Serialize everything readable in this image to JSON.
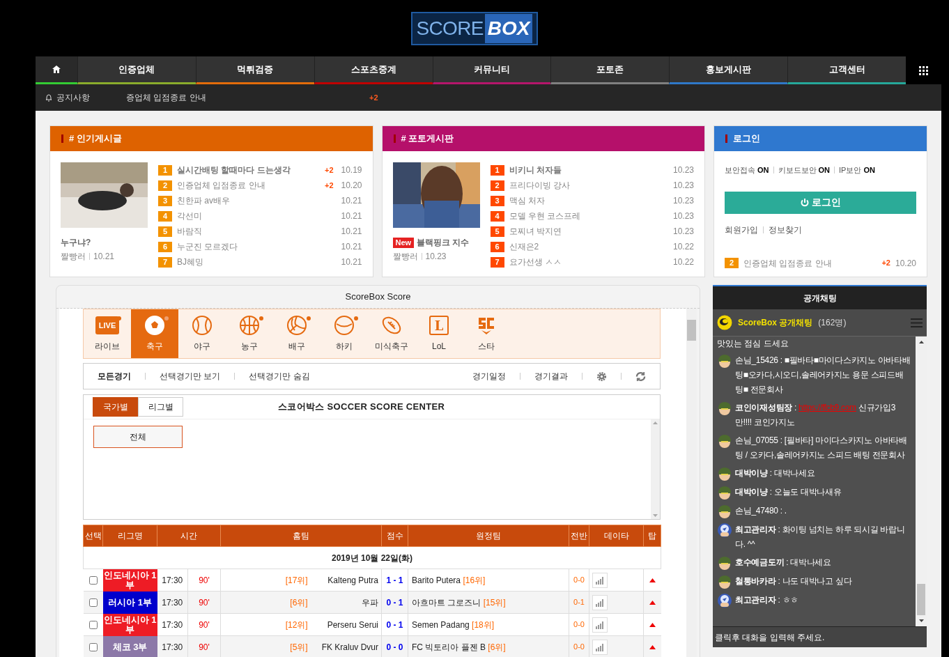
{
  "logo": {
    "left": "SCORE",
    "right": "BOX"
  },
  "nav": {
    "items": [
      {
        "label": "인증업체",
        "color": "#8aac2c"
      },
      {
        "label": "먹튀검증",
        "color": "#e36c0a"
      },
      {
        "label": "스포츠중계",
        "color": "#c00000"
      },
      {
        "label": "커뮤니티",
        "color": "#b5166b"
      },
      {
        "label": "포토존",
        "color": "#808080"
      },
      {
        "label": "홍보게시판",
        "color": "#2f78c8"
      },
      {
        "label": "고객센터",
        "color": "#25a89a"
      }
    ]
  },
  "notice": {
    "label": "공지사항",
    "text": "증업체 입점종료 안내",
    "count": "+2"
  },
  "popular": {
    "title": "# 인기게시글",
    "feature": {
      "title": "누구냐?",
      "author": "짤빵러",
      "date": "10.21"
    },
    "items": [
      {
        "rank": "1",
        "title": "실시간배팅 할때마다 드는생각",
        "bold": true,
        "count": "+2",
        "date": "10.19"
      },
      {
        "rank": "2",
        "title": "인증업체 입점종료 안내",
        "bold": false,
        "count": "+2",
        "date": "10.20"
      },
      {
        "rank": "3",
        "title": "친한파 av배우",
        "bold": false,
        "date": "10.21"
      },
      {
        "rank": "4",
        "title": "각선미",
        "bold": false,
        "date": "10.21"
      },
      {
        "rank": "5",
        "title": "바람직",
        "bold": false,
        "date": "10.21"
      },
      {
        "rank": "6",
        "title": "누군진 모르겠다",
        "bold": false,
        "date": "10.21"
      },
      {
        "rank": "7",
        "title": "BJ혜밍",
        "bold": false,
        "date": "10.21"
      }
    ]
  },
  "photo": {
    "title": "# 포토게시판",
    "feature": {
      "badge": "New",
      "title": "블랙핑크 지수",
      "author": "짤빵러",
      "date": "10.23"
    },
    "items": [
      {
        "rank": "1",
        "title": "비키니 처자들",
        "bold": true,
        "date": "10.23"
      },
      {
        "rank": "2",
        "title": "프리다이빙 강사",
        "bold": false,
        "date": "10.23"
      },
      {
        "rank": "3",
        "title": "맥심 처자",
        "bold": false,
        "date": "10.23"
      },
      {
        "rank": "4",
        "title": "모델 우현 코스프레",
        "bold": false,
        "date": "10.23"
      },
      {
        "rank": "5",
        "title": "모찌녀 박지연",
        "bold": false,
        "date": "10.23"
      },
      {
        "rank": "6",
        "title": "신재은2",
        "bold": false,
        "date": "10.22"
      },
      {
        "rank": "7",
        "title": "요가선생 ㅅㅅ",
        "bold": false,
        "date": "10.22"
      }
    ]
  },
  "login": {
    "title": "로그인",
    "security": [
      {
        "label": "보안접속",
        "value": "ON"
      },
      {
        "label": "키보드보안",
        "value": "ON"
      },
      {
        "label": "IP보안",
        "value": "ON"
      }
    ],
    "button": "로그인",
    "links": [
      "회원가입",
      "정보찾기"
    ],
    "notice": {
      "rank": "2",
      "title": "인증업체 입점종료 안내",
      "count": "+2",
      "date": "10.20"
    }
  },
  "score": {
    "title": "ScoreBox Score",
    "sports": [
      {
        "kind": "live",
        "label": "라이브",
        "badge": "LIVE",
        "dot": true,
        "selected": false
      },
      {
        "kind": "soccer",
        "label": "축구",
        "dot": true,
        "selected": true
      },
      {
        "kind": "baseball",
        "label": "야구",
        "dot": false,
        "selected": false
      },
      {
        "kind": "basketball",
        "label": "농구",
        "dot": true,
        "selected": false
      },
      {
        "kind": "volleyball",
        "label": "배구",
        "dot": true,
        "selected": false
      },
      {
        "kind": "hockey",
        "label": "하키",
        "dot": true,
        "selected": false
      },
      {
        "kind": "football",
        "label": "미식축구",
        "dot": false,
        "selected": false
      },
      {
        "kind": "lol",
        "label": "LoL",
        "badge": "L",
        "dot": false,
        "selected": false
      },
      {
        "kind": "star",
        "label": "스타",
        "dot": false,
        "selected": false
      }
    ],
    "filters": [
      {
        "label": "모든경기",
        "selected": true
      },
      {
        "label": "선택경기만 보기",
        "selected": false
      },
      {
        "label": "선택경기만 숨김",
        "selected": false
      }
    ],
    "links": [
      "경기일정",
      "경기결과"
    ],
    "view_tabs": [
      {
        "label": "국가별",
        "selected": true
      },
      {
        "label": "리그별",
        "selected": false
      }
    ],
    "center_title": "스코어박스 SOCCER SCORE CENTER",
    "country_button": "전체",
    "table": {
      "columns": [
        "선택",
        "리그명",
        "시간",
        "홈팀",
        "점수",
        "원정팀",
        "전반",
        "데이타",
        "탑"
      ],
      "date": "2019년 10월 22일(화)",
      "rows": [
        {
          "checked": false,
          "league": "인도네시아 1부",
          "color": "#ee1c25",
          "time": "17:30",
          "minute": "90'",
          "home_rank": "[17위]",
          "home": "Kalteng Putra",
          "score": "1 - 1",
          "away": "Barito Putera",
          "away_rank": "[16위]",
          "half": "0-0"
        },
        {
          "checked": false,
          "league": "러시아 1부",
          "color": "#0000cc",
          "time": "17:30",
          "minute": "90'",
          "home_rank": "[6위]",
          "home": "우파",
          "score": "0 - 1",
          "away": "아흐마트 그로즈니",
          "away_rank": "[15위]",
          "half": "0-1"
        },
        {
          "checked": false,
          "league": "인도네시아 1부",
          "color": "#ee1c25",
          "time": "17:30",
          "minute": "90'",
          "home_rank": "[12위]",
          "home": "Perseru Serui",
          "score": "0 - 1",
          "away": "Semen Padang",
          "away_rank": "[18위]",
          "half": "0-0"
        },
        {
          "checked": false,
          "league": "체코 3부",
          "color": "#8c78a8",
          "time": "17:30",
          "minute": "90'",
          "home_rank": "[5위]",
          "home": "FK Kraluv Dvur",
          "score": "0 - 0",
          "away": "FC 빅토리아 플젠 B",
          "away_rank": "[6위]",
          "half": "0-0"
        }
      ]
    }
  },
  "chat": {
    "title": "공개채팅",
    "room": "ScoreBox 공개채팅",
    "count": "(162명)",
    "messages": [
      {
        "kind": "text",
        "text": "맛있는 점심 드세요"
      },
      {
        "kind": "soldier",
        "user": "손님_15426",
        "bold": false,
        "text": ": ■필바타■마이다스카지노 아바타배팅■오카다,시오디,솔레어카지노 용문 스피드배팅■ 전문회사"
      },
      {
        "kind": "soldier",
        "user": "코인이재성팀장",
        "bold": true,
        "text": ":",
        "link": "https://ffcb9.com",
        "link_after": "신규가입3만!!!! 코인가지노"
      },
      {
        "kind": "soldier",
        "user": "손님_07055",
        "bold": false,
        "text": ": [필바타] 마이다스카지노 아바타배팅 / 오카다,솔레어카지노 스피드 배팅 전문회사"
      },
      {
        "kind": "soldier",
        "user": "대박이냥",
        "bold": true,
        "text": ": 대박나세요"
      },
      {
        "kind": "soldier",
        "user": "대박이냥",
        "bold": true,
        "text": ": 오늘도 대박나새유"
      },
      {
        "kind": "soldier",
        "user": "손님_47480",
        "bold": false,
        "text": ": ."
      },
      {
        "kind": "admin",
        "user": "최고관리자",
        "bold": true,
        "text": ": 화이팅 넘치는 하루 되시길 바랍니다. ^^"
      },
      {
        "kind": "soldier",
        "user": "호수예금도끼",
        "bold": true,
        "text": ": 대박나세요"
      },
      {
        "kind": "soldier",
        "user": "철통바카라",
        "bold": true,
        "text": ": 나도 대박나고 싶다"
      },
      {
        "kind": "admin",
        "user": "최고관리자",
        "bold": true,
        "text": ": ㅎㅎ"
      }
    ],
    "placeholder": "클릭후 대화을 입력해 주세요."
  }
}
